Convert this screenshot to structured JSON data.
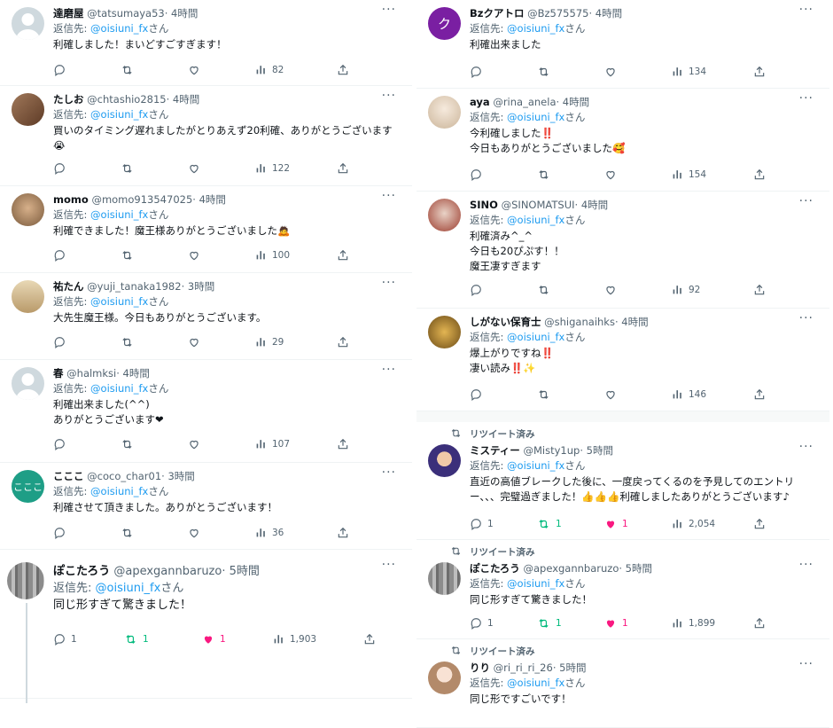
{
  "left": [
    {
      "name": "達磨屋",
      "handle": "@tatsumaya53",
      "time": "· 4時間",
      "reply_label": "返信先: ",
      "reply_to": "@oisiuni_fx",
      "reply_suffix": "さん",
      "text": "利確しました！まいどすごすぎます！",
      "views": "82",
      "avatar": "default"
    },
    {
      "name": "たしお",
      "handle": "@chtashio2815",
      "time": "· 4時間",
      "reply_label": "返信先: ",
      "reply_to": "@oisiuni_fx",
      "reply_suffix": "さん",
      "text": "買いのタイミング遅れましたがとりあえず20利確、ありがとうございます\n😭",
      "views": "122",
      "avatar": "brown"
    },
    {
      "name": "momo",
      "handle": "@momo913547025",
      "time": "· 4時間",
      "reply_label": "返信先: ",
      "reply_to": "@oisiuni_fx",
      "reply_suffix": "さん",
      "text": "利確できました！魔王様ありがとうございました🙇",
      "views": "100",
      "avatar": "dog"
    },
    {
      "name": "祐たん",
      "handle": "@yuji_tanaka1982",
      "time": "· 3時間",
      "reply_label": "返信先: ",
      "reply_to": "@oisiuni_fx",
      "reply_suffix": "さん",
      "text": "大先生魔王様。今日もありがとうございます。",
      "views": "29",
      "avatar": "beige"
    },
    {
      "name": "春",
      "handle": "@halmksi",
      "time": "· 4時間",
      "reply_label": "返信先: ",
      "reply_to": "@oisiuni_fx",
      "reply_suffix": "さん",
      "text": "利確出来ました(^^)\nありがとうございます❤",
      "views": "107",
      "avatar": "default"
    },
    {
      "name": "こここ",
      "handle": "@coco_char01",
      "time": "· 3時間",
      "reply_label": "返信先: ",
      "reply_to": "@oisiuni_fx",
      "reply_suffix": "さん",
      "text": "利確させて頂きました。ありがとうございます！",
      "views": "36",
      "avatar": "green",
      "avatar_text": "こここ"
    },
    {
      "name": "ぽこたろう",
      "handle": "@apexgannbaruzo",
      "time": "· 5時間",
      "reply_label": "返信先: ",
      "reply_to": "@oisiuni_fx",
      "reply_suffix": "さん",
      "text": "同じ形すぎて驚きました！",
      "replies": "1",
      "retweets": "1",
      "likes": "1",
      "views": "1,903",
      "avatar": "cans"
    }
  ],
  "right": [
    {
      "name": "Bzクアトロ",
      "handle": "@Bz575575",
      "time": "· 4時間",
      "reply_label": "返信先: ",
      "reply_to": "@oisiuni_fx",
      "reply_suffix": "さん",
      "text": "利確出来ました",
      "views": "134",
      "avatar": "purple",
      "avatar_text": "ク"
    },
    {
      "name": "aya",
      "handle": "@rina_anela",
      "time": "· 4時間",
      "reply_label": "返信先: ",
      "reply_to": "@oisiuni_fx",
      "reply_suffix": "さん",
      "text": "今利確しました‼️\n今日もありがとうございました🥰",
      "views": "154",
      "avatar": "light"
    },
    {
      "name": "SINO",
      "handle": "@SINOMATSUI",
      "time": "· 4時間",
      "reply_label": "返信先: ",
      "reply_to": "@oisiuni_fx",
      "reply_suffix": "さん",
      "text": "利確済み^_^\n今日も20ぴぷす！！\n魔王凄すぎます",
      "views": "92",
      "avatar": "red"
    },
    {
      "name": "しがない保育士",
      "handle": "@shiganaihks",
      "time": "· 4時間",
      "reply_label": "返信先: ",
      "reply_to": "@oisiuni_fx",
      "reply_suffix": "さん",
      "text": "爆上がりですね‼️\n凄い読み‼️✨",
      "views": "146",
      "avatar": "gold"
    },
    {
      "retweet_note": "リツイート済み",
      "name": "ミスティー",
      "handle": "@Misty1up",
      "time": "· 5時間",
      "reply_label": "返信先: ",
      "reply_to": "@oisiuni_fx",
      "reply_suffix": "さん",
      "text": "直近の高値ブレークした後に、一度戻ってくるのを予見してのエントリ\nー、、、完璧過ぎました！👍👍👍利確しましたありがとうございます♪",
      "replies": "1",
      "retweets": "1",
      "likes": "1",
      "views": "2,054",
      "avatar": "navy"
    },
    {
      "retweet_note": "リツイート済み",
      "name": "ぽこたろう",
      "handle": "@apexgannbaruzo",
      "time": "· 5時間",
      "reply_label": "返信先: ",
      "reply_to": "@oisiuni_fx",
      "reply_suffix": "さん",
      "text": "同じ形すぎて驚きました！",
      "replies": "1",
      "retweets": "1",
      "likes": "1",
      "views": "1,899",
      "avatar": "cans"
    },
    {
      "retweet_note": "リツイート済み",
      "name": "りり",
      "handle": "@ri_ri_ri_26",
      "time": "· 5時間",
      "reply_label": "返信先: ",
      "reply_to": "@oisiuni_fx",
      "reply_suffix": "さん",
      "text": "同じ形ですごいです！",
      "avatar": "girl"
    }
  ],
  "colors": {
    "link": "#1d9bf0",
    "muted": "#536471",
    "retweet": "#00ba7c",
    "like": "#f91880"
  }
}
